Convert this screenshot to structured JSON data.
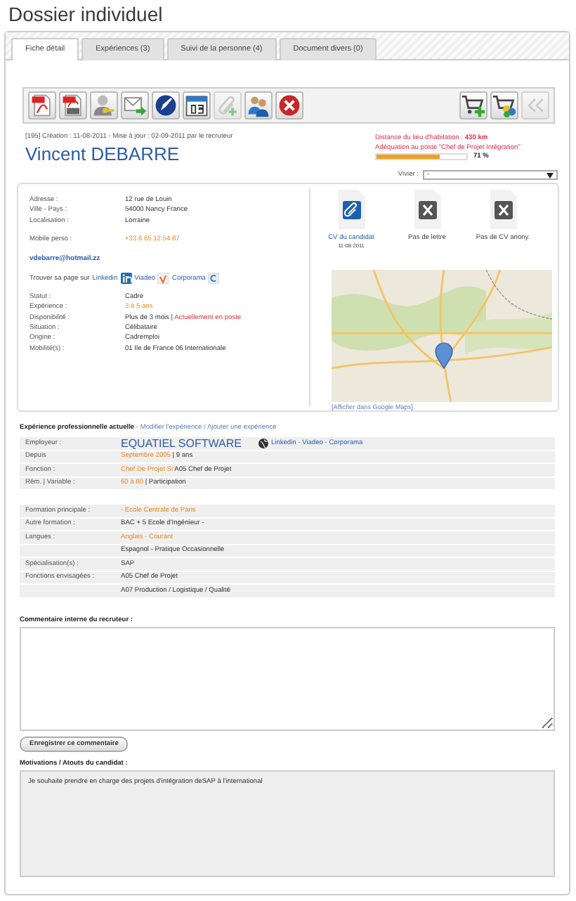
{
  "page_title": "Dossier individuel",
  "tabs": [
    {
      "label": "Fiche détail",
      "selected": true
    },
    {
      "label": "Expériences (3)",
      "selected": false
    },
    {
      "label": "Suivi de la personne (4)",
      "selected": false
    },
    {
      "label": "Document divers (0)",
      "selected": false
    }
  ],
  "toolbar": {
    "left": [
      {
        "disabled": false
      },
      {
        "disabled": false
      },
      {
        "disabled": false
      },
      {
        "disabled": false
      },
      {
        "disabled": false
      },
      {
        "disabled": false
      },
      {
        "disabled": true
      },
      {
        "disabled": false
      },
      {
        "disabled": false
      }
    ],
    "right": [
      {
        "disabled": false
      },
      {
        "disabled": false
      },
      {
        "disabled": true
      }
    ]
  },
  "record": {
    "meta": "[195] Création : 11-08-2011 - Mise à jour : 02-09-2011 par le recruteur",
    "name": "Vincent DEBARRE",
    "distance": "Distance du lieu d'habitation : **430 km**",
    "match": {
      "label": "Adéquation au poste \"Chef de Projet Intégration\"",
      "level": 0.71,
      "reading": "71 %"
    }
  },
  "vivier": {
    "label": "Vivier :",
    "value": "-"
  },
  "contact": {
    "address_rows": [
      {
        "label": "Adresse :",
        "value": [
          {
            "kind": "plain",
            "text": "12 rue de Louin"
          }
        ]
      },
      {
        "label": "Ville - Pays :",
        "value": [
          {
            "kind": "plain",
            "text": "54000 Nancy France"
          }
        ]
      },
      {
        "label": "Localisation :",
        "value": [
          {
            "kind": "plain",
            "text": "Lorraine"
          }
        ]
      }
    ],
    "phone_rows": [
      {
        "label": "Mobile perso :",
        "value": [
          {
            "kind": "highlight",
            "text": "+33 6 65 12 54 87"
          }
        ]
      }
    ],
    "email": "vdebarre@hotmail.zz",
    "find": {
      "text": "Trouver sa page sur",
      "links": [
        "Linkedin",
        "Viadeo",
        "Corporama"
      ]
    },
    "status_rows": [
      {
        "label": "Statut :",
        "value": [
          {
            "kind": "plain",
            "text": "Cadre"
          }
        ]
      },
      {
        "label": "Expérience :",
        "value": [
          {
            "kind": "highlight",
            "text": "3 à 5 ans"
          }
        ]
      },
      {
        "label": "Disponibilité :",
        "value": [
          {
            "kind": "plain",
            "text": "Plus de 3 mois | "
          },
          {
            "kind": "alert",
            "text": "Actuellement en poste"
          }
        ]
      },
      {
        "label": "Situation :",
        "value": [
          {
            "kind": "plain",
            "text": "Célibataire"
          }
        ]
      },
      {
        "label": "Origine :",
        "value": [
          {
            "kind": "plain",
            "text": "Cadremploi"
          }
        ]
      },
      {
        "label": "Mobilité(s) :",
        "value": [
          {
            "kind": "plain",
            "text": "01 Ile de France 06 Internationale"
          }
        ]
      }
    ]
  },
  "documents": [
    {
      "label": "CV du candidat",
      "date": "11-08-2011",
      "available": true
    },
    {
      "label": "Pas de lettre",
      "available": false
    },
    {
      "label": "Pas de CV anony.",
      "available": false
    }
  ],
  "map": {
    "link": "[Afficher dans Google Maps]"
  },
  "experience": {
    "heading": "Expérience professionnelle actuelle",
    "joiners": [
      " - ",
      " / "
    ],
    "actions": [
      "Modifier l'expérience",
      "Ajouter une expérience"
    ],
    "employer": {
      "label": "Employeur :",
      "name": "EQUATIEL SOFTWARE",
      "links": [
        "Linkedin",
        "Viadeo",
        "Corporama"
      ],
      "link_separator": " - "
    },
    "rows": [
      {
        "label": "Depuis",
        "value": [
          {
            "kind": "highlight",
            "text": "Septembre 2005"
          },
          {
            "kind": "plain",
            "text": " | 9 ans"
          }
        ]
      },
      {
        "label": "Fonction :",
        "value": [
          {
            "kind": "highlight",
            "text": "Chef De Projet Si"
          },
          {
            "kind": "plain",
            "text": " A05 Chef de Projet"
          }
        ]
      },
      {
        "label": "Rém. | Variable :",
        "value": [
          {
            "kind": "highlight",
            "text": "60 à 80"
          },
          {
            "kind": "plain",
            "text": " | Participation"
          }
        ]
      }
    ]
  },
  "education": [
    {
      "label": "Formation principale :",
      "value": [
        {
          "kind": "highlight",
          "text": "- Ecole Centrale de Paris"
        }
      ]
    },
    {
      "label": "Autre formation :",
      "value": [
        {
          "kind": "plain",
          "text": "BAC + 5 Ecole d'Ingénieur -"
        }
      ]
    },
    {
      "label": "Langues :",
      "value": [
        {
          "kind": "highlight",
          "text": "Anglais - Courant"
        }
      ]
    },
    {
      "value": [
        {
          "kind": "plain",
          "text": "Espagnol - Pratique Occasionnelle"
        }
      ]
    },
    {
      "label": "Spécialisation(s) :",
      "value": [
        {
          "kind": "plain",
          "text": "SAP"
        }
      ]
    },
    {
      "label": "Fonctions envisagées :",
      "value": [
        {
          "kind": "plain",
          "text": "A05 Chef de Projet"
        }
      ]
    },
    {
      "value": [
        {
          "kind": "plain",
          "text": "A07 Production / Logistique / Qualité"
        }
      ]
    }
  ],
  "comment": {
    "label": "Commentaire interne du recruteur :",
    "button": "Enregistrer ce commentaire"
  },
  "motivations": {
    "label": "Motivations / Atouts du candidat :",
    "text": "Je souhaite prendre en charge des projets d'intégration deSAP à l'international"
  }
}
